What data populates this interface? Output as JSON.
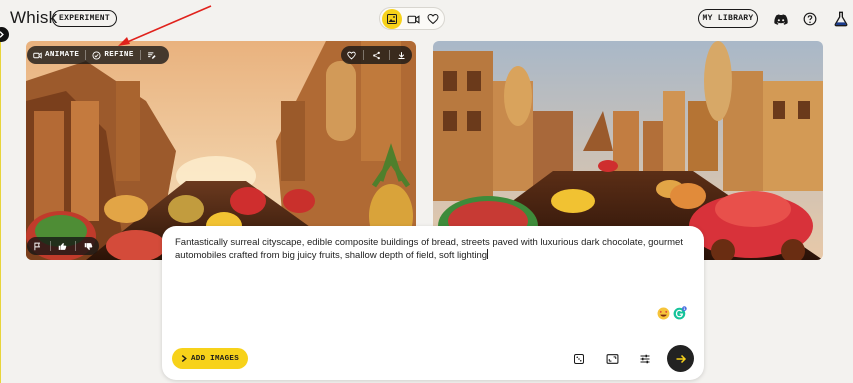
{
  "app": {
    "title": "Whisk",
    "badge": "EXPERIMENT"
  },
  "header": {
    "modes": [
      {
        "icon": "image-mode-icon",
        "active": true
      },
      {
        "icon": "video-mode-icon",
        "active": false
      },
      {
        "icon": "heart-icon",
        "active": false
      }
    ],
    "library_label": "MY LIBRARY",
    "right_icons": [
      "discord-icon",
      "help-icon",
      "flask-icon"
    ]
  },
  "image_left": {
    "toolbar": {
      "animate_label": "ANIMATE",
      "refine_label": "REFINE"
    },
    "top_right_icons": [
      "heart-icon",
      "share-icon",
      "download-icon"
    ],
    "bottom_icons": [
      "flag-icon",
      "thumbs-up-icon",
      "thumbs-down-icon"
    ]
  },
  "prompt": {
    "text": "Fantastically surreal cityscape, edible composite buildings of bread, streets paved with luxurious dark chocolate, gourmet automobiles crafted from big juicy fruits, shallow depth of field, soft lighting",
    "add_images_label": "ADD IMAGES",
    "tools": [
      "dice-icon",
      "aspect-ratio-icon",
      "settings-sliders-icon"
    ],
    "submit_icon": "arrow-right-icon"
  },
  "colors": {
    "accent": "#f7d21a",
    "dark": "#1a1a1a",
    "annotation": "#e0221c"
  }
}
